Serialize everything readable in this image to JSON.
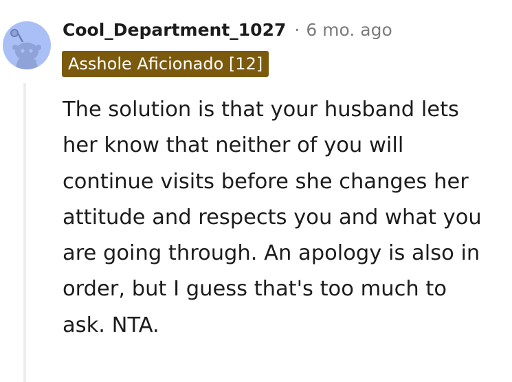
{
  "comment": {
    "username": "Cool_Department_1027",
    "separator": "·",
    "timestamp": "6 mo. ago",
    "flair": "Asshole Aficionado [12]",
    "body": "The solution is that your husband lets her know that neither of you will continue visits before she changes her attitude and respects you and what you are going through. An apology is also in order, but I guess that's too much to ask. NTA.",
    "avatar_icon": "snoo-avatar-icon"
  },
  "colors": {
    "avatar_bg": "#a9bff5",
    "flair_bg": "#7b5a0d",
    "flair_text": "#ffffff",
    "meta_text": "#7c7c7c",
    "body_text": "#1c1c1c",
    "thread_line": "#ededed"
  }
}
